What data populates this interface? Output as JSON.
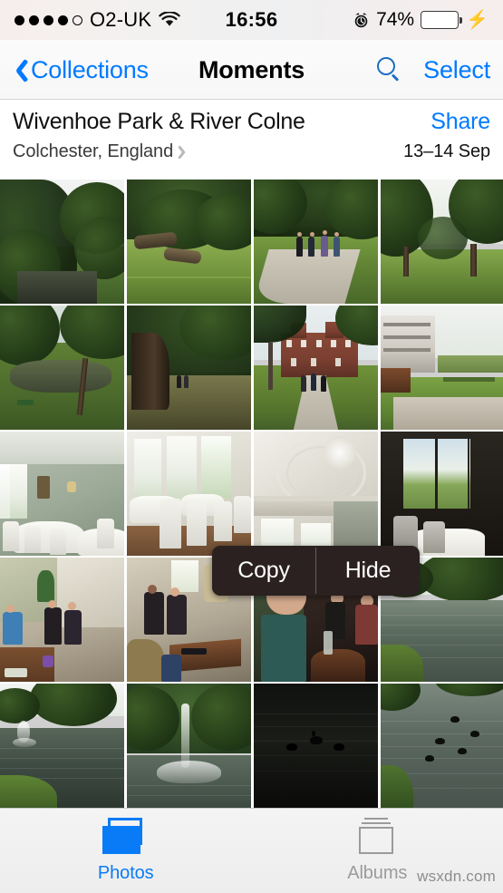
{
  "status_bar": {
    "signal_dots_filled": 4,
    "signal_dots_total": 5,
    "carrier": "O2-UK",
    "wifi_icon": "wifi-icon",
    "time": "16:56",
    "alarm_icon": "alarm-clock-icon",
    "battery_percent": "74%",
    "battery_level": 74,
    "battery_color": "#4cd764",
    "charging_icon": "lightning-bolt-icon"
  },
  "nav_bar": {
    "back_label": "Collections",
    "back_icon": "chevron-left-icon",
    "title": "Moments",
    "search_icon": "search-icon",
    "select_label": "Select",
    "accent_color": "#007aff"
  },
  "moment": {
    "title": "Wivenhoe Park & River Colne",
    "location": "Colchester, England",
    "location_chevron": "chevron-right-icon",
    "share_label": "Share",
    "date_range": "13–14 Sep"
  },
  "grid": {
    "columns": 4,
    "rows": [
      {
        "photos": [
          {
            "id": "p1",
            "alt": "Dense green trees beside river, bright overcast sky"
          },
          {
            "id": "p2",
            "alt": "Fallen logs on grassy bank with shrubbery"
          },
          {
            "id": "p3",
            "alt": "Four people walking on a park path under trees"
          },
          {
            "id": "p4",
            "alt": "Open parkland with large trees and lawn"
          }
        ]
      },
      {
        "photos": [
          {
            "id": "p5",
            "alt": "Park lake with willow trees and bench"
          },
          {
            "id": "p6",
            "alt": "Huge old tree trunk with spreading canopy"
          },
          {
            "id": "p7",
            "alt": "Red-brick Wivenhoe House mansion with people on path"
          },
          {
            "id": "p8",
            "alt": "Modern campus building overlooking manicured lawn"
          }
        ]
      },
      {
        "photos": [
          {
            "id": "p9",
            "alt": "Green-walled banquet room set with round tables"
          },
          {
            "id": "p10",
            "alt": "Sunlit dining room with white chair covers"
          },
          {
            "id": "p11",
            "alt": "Ornate white plaster ceiling detail"
          },
          {
            "id": "p12",
            "alt": "Dark curtained window with view over lawn"
          }
        ]
      },
      {
        "photos": [
          {
            "id": "p13",
            "alt": "People sitting and chatting in hotel lounge"
          },
          {
            "id": "p14",
            "alt": "Group of friends seated around low table"
          },
          {
            "id": "p15",
            "alt": "Woman with glasses smiling in a pub"
          },
          {
            "id": "p16",
            "alt": "River with green banks and trees"
          }
        ]
      },
      {
        "photos": [
          {
            "id": "p17",
            "alt": "Lake with small fountain and trees"
          },
          {
            "id": "p18",
            "alt": "Large fountain spraying on the lake"
          },
          {
            "id": "p19",
            "alt": "Dark water with silhouetted ducks"
          },
          {
            "id": "p20",
            "alt": "River with ducks and rippling water"
          }
        ]
      }
    ]
  },
  "popup_menu": {
    "items": [
      {
        "label": "Copy"
      },
      {
        "label": "Hide"
      }
    ],
    "background_color": "#2b2120"
  },
  "tab_bar": {
    "tabs": [
      {
        "label": "Photos",
        "icon": "photos-stack-icon",
        "active": true
      },
      {
        "label": "Albums",
        "icon": "albums-stack-icon",
        "active": false
      }
    ],
    "active_color": "#0a7bf7",
    "inactive_color": "#9b9b9e"
  },
  "watermark": {
    "text": "wsxdn.com"
  }
}
